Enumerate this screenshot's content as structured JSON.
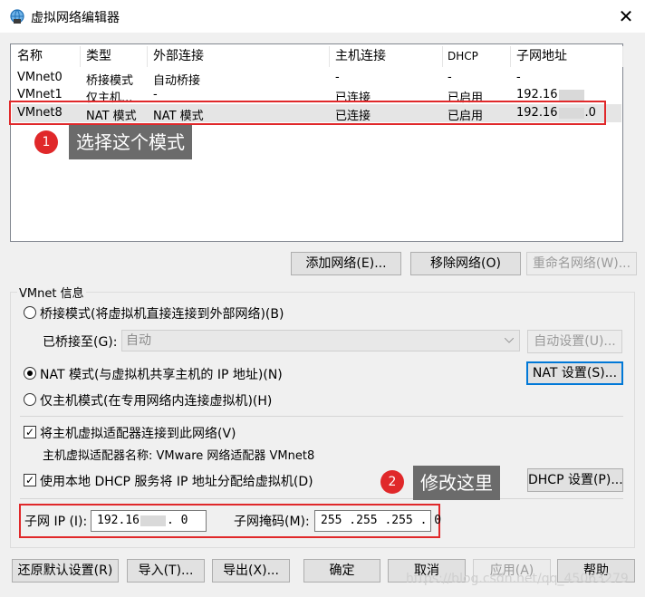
{
  "window": {
    "title": "虚拟网络编辑器",
    "close_glyph": "✕"
  },
  "table": {
    "columns": [
      "名称",
      "类型",
      "外部连接",
      "主机连接",
      "DHCP",
      "子网地址"
    ],
    "rows": [
      {
        "name": "VMnet0",
        "type": "桥接模式",
        "external": "自动桥接",
        "host": "-",
        "dhcp": "-",
        "subnet": "-"
      },
      {
        "name": "VMnet1",
        "type": "仅主机...",
        "external": "-",
        "host": "已连接",
        "dhcp": "已启用",
        "subnet_prefix": "192.16",
        "subnet_suffix": ""
      },
      {
        "name": "VMnet8",
        "type": "NAT 模式",
        "external": "NAT 模式",
        "host": "已连接",
        "dhcp": "已启用",
        "subnet_prefix": "192.16",
        "subnet_suffix": ".0"
      }
    ]
  },
  "annotations": {
    "step1": {
      "number": "1",
      "text": "选择这个模式"
    },
    "step2": {
      "number": "2",
      "text": "修改这里"
    }
  },
  "network_buttons": {
    "add": "添加网络(E)...",
    "remove": "移除网络(O)",
    "rename": "重命名网络(W)..."
  },
  "vmnet_info": {
    "legend": "VMnet 信息",
    "bridged_label": "桥接模式(将虚拟机直接连接到外部网络)(B)",
    "bridged_to_label": "已桥接至(G):",
    "bridged_to_value": "自动",
    "auto_settings": "自动设置(U)...",
    "nat_label": "NAT 模式(与虚拟机共享主机的 IP 地址)(N)",
    "nat_settings": "NAT 设置(S)...",
    "hostonly_label": "仅主机模式(在专用网络内连接虚拟机)(H)",
    "connect_adapter_label": "将主机虚拟适配器连接到此网络(V)",
    "adapter_name_label": "主机虚拟适配器名称: VMware 网络适配器 VMnet8",
    "dhcp_label": "使用本地 DHCP 服务将 IP 地址分配给虚拟机(D)",
    "dhcp_settings": "DHCP 设置(P)...",
    "subnet_ip_label": "子网 IP (I):",
    "subnet_ip_prefix": "192.16",
    "subnet_ip_suffix": ". 0",
    "subnet_mask_label": "子网掩码(M):",
    "subnet_mask_value": "255 .255 .255 . 0",
    "selected_mode": "nat",
    "connect_adapter_checked": true,
    "dhcp_checked": true
  },
  "footer": {
    "restore": "还原默认设置(R)",
    "import": "导入(T)...",
    "export": "导出(X)...",
    "ok": "确定",
    "cancel": "取消",
    "apply": "应用(A)",
    "help": "帮助",
    "watermark": "https://blog.csdn.net/qq_45063279"
  },
  "colors": {
    "annotation_red": "#e0282a",
    "focus_blue": "#0078d7",
    "callout_gray": "#6b6b6b"
  }
}
